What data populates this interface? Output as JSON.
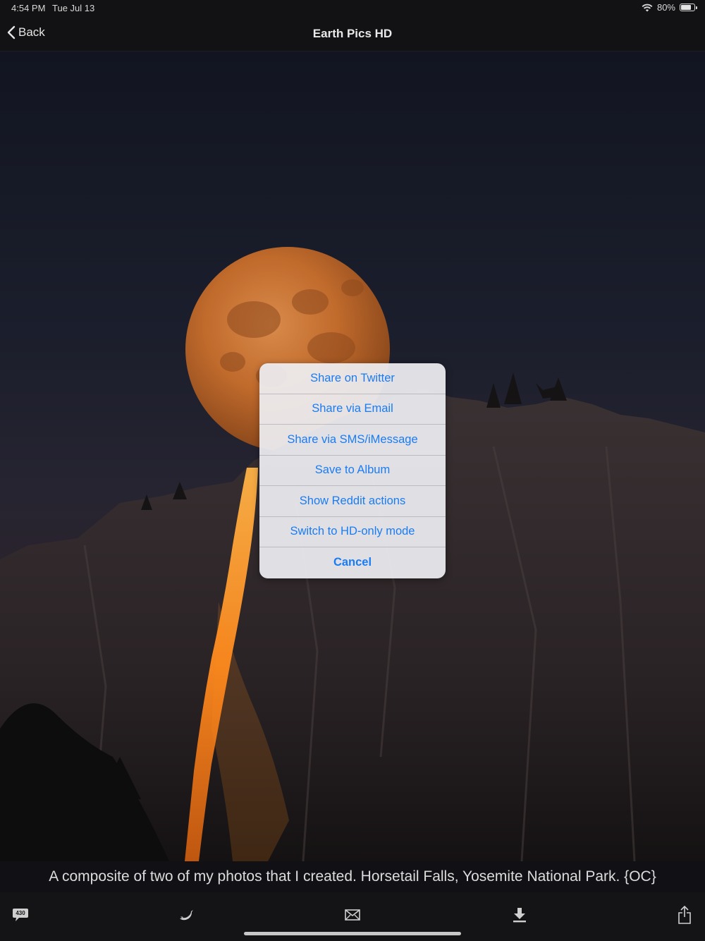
{
  "status": {
    "time": "4:54 PM",
    "date": "Tue Jul 13",
    "battery": "80%",
    "battery_level": 0.8
  },
  "nav": {
    "back_label": "Back",
    "title": "Earth Pics HD"
  },
  "photo": {
    "caption": "A composite of two of my photos that I created. Horsetail Falls, Yosemite National Park. {OC}"
  },
  "action_sheet": {
    "items": [
      {
        "label": "Share on Twitter"
      },
      {
        "label": "Share via Email"
      },
      {
        "label": "Share via SMS/iMessage"
      },
      {
        "label": "Save to Album"
      },
      {
        "label": "Show Reddit actions"
      },
      {
        "label": "Switch to HD-only mode"
      },
      {
        "label": "Cancel"
      }
    ]
  },
  "toolbar": {
    "comments_count": "430",
    "icons": [
      "comments-icon",
      "twitter-icon",
      "mail-icon",
      "download-icon",
      "share-icon"
    ]
  },
  "colors": {
    "accent": "#1a7cf2",
    "moon": "#c76a2a",
    "waterfall": "#ff8a1e"
  }
}
